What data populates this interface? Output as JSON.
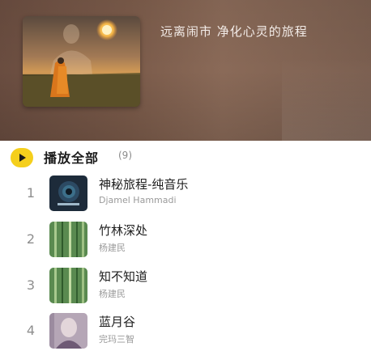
{
  "album": {
    "title": "远离闹市  净化心灵的旅程",
    "cover_icon": "monk-sunset-cover"
  },
  "play_all": {
    "label": "播放全部",
    "count": "(9)",
    "icon": "play-icon",
    "accent_color": "#f5cf1c"
  },
  "tracks": [
    {
      "index": "1",
      "title": "神秘旅程-纯音乐",
      "artist": "Djamel Hammadi",
      "thumb": "dark-blue-album-art"
    },
    {
      "index": "2",
      "title": "竹林深处",
      "artist": "杨建民",
      "thumb": "bamboo-album-art"
    },
    {
      "index": "3",
      "title": "知不知道",
      "artist": "杨建民",
      "thumb": "bamboo-album-art"
    },
    {
      "index": "4",
      "title": "蓝月谷",
      "artist": "完玛三智",
      "thumb": "portrait-album-art"
    }
  ]
}
